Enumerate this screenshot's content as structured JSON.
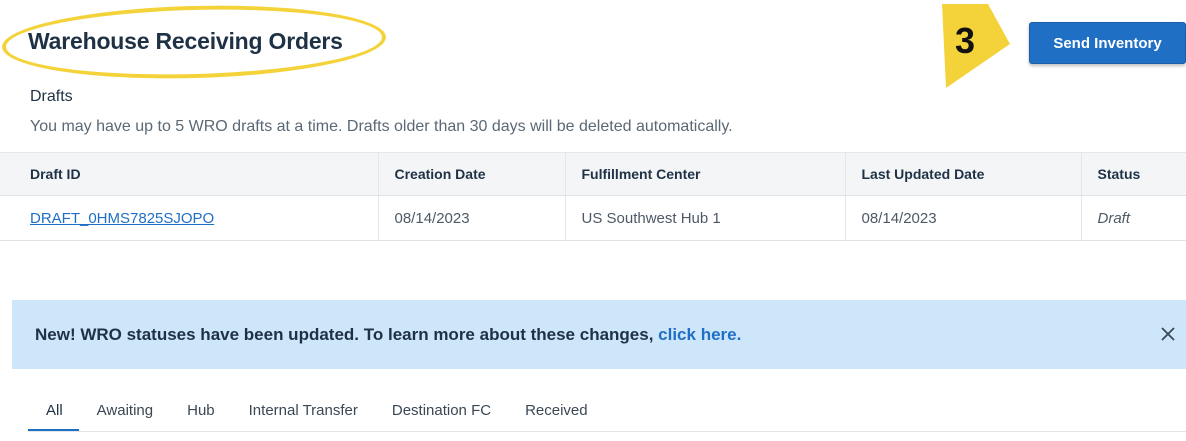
{
  "header": {
    "title": "Warehouse Receiving Orders",
    "step_number": "3",
    "send_inventory_label": "Send Inventory"
  },
  "drafts": {
    "heading": "Drafts",
    "note": "You may have up to 5 WRO drafts at a time. Drafts older than 30 days will be deleted automatically.",
    "columns": [
      "Draft ID",
      "Creation Date",
      "Fulfillment Center",
      "Last Updated Date",
      "Status"
    ],
    "rows": [
      {
        "draft_id": "DRAFT_0HMS7825SJOPO",
        "creation_date": "08/14/2023",
        "fulfillment_center": "US Southwest Hub 1",
        "last_updated": "08/14/2023",
        "status": "Draft"
      }
    ]
  },
  "banner": {
    "text": "New! WRO statuses have been updated. To learn more about these changes, ",
    "link_text": "click here."
  },
  "tabs": [
    "All",
    "Awaiting",
    "Hub",
    "Internal Transfer",
    "Destination FC",
    "Received"
  ],
  "colors": {
    "accent": "#1f6fc5",
    "highlight": "#f4d33a",
    "banner_bg": "#cde6fa",
    "title_text": "#1f3145"
  },
  "icons": {
    "close": "close-icon",
    "step_arrow": "step-arrow-icon"
  }
}
